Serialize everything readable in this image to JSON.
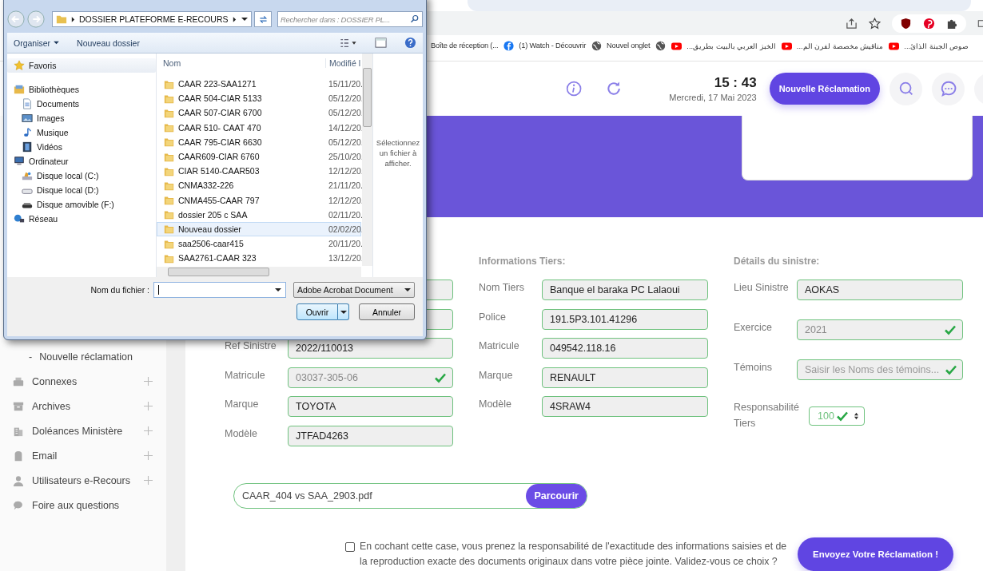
{
  "browser": {
    "bookmarks": [
      {
        "kind": "none",
        "label": "Boîte de réception (..."
      },
      {
        "kind": "facebook",
        "label": "(1) Watch - Découvrir"
      },
      {
        "kind": "globe",
        "label": "Nouvel onglet"
      },
      {
        "kind": "globe"
      },
      {
        "kind": "youtube",
        "label": "الخبز العربي بالبيت بطريق..."
      },
      {
        "kind": "youtube",
        "label": "مناقيش مخصصة لفرن الم..."
      },
      {
        "kind": "youtube",
        "label": "صوص الجبنة الذائ..."
      }
    ]
  },
  "header": {
    "time": "15 : 43",
    "date": "Mercredi, 17 Mai 2023",
    "new_button": "Nouvelle Réclamation"
  },
  "sidebar": {
    "items": [
      {
        "kind": "sub",
        "label": "Nouvelle réclamation",
        "marker": "-"
      },
      {
        "kind": "printer",
        "label": "Connexes",
        "expandable": true
      },
      {
        "kind": "archive",
        "label": "Archives",
        "expandable": true
      },
      {
        "kind": "building",
        "label": "Doléances Ministère",
        "expandable": true
      },
      {
        "kind": "mailbox",
        "label": "Email",
        "expandable": true
      },
      {
        "kind": "user",
        "label": "Utilisateurs e-Recours",
        "expandable": true
      },
      {
        "kind": "faq",
        "label": "Foire aux questions",
        "expandable": false
      }
    ]
  },
  "form": {
    "columns": [
      {
        "fields": [
          {
            "kind": "covered"
          },
          {
            "kind": "covered"
          },
          {
            "kind": "field",
            "label": "Ref Sinistre",
            "value": "2022/110013",
            "valid": false
          },
          {
            "kind": "field",
            "label": "Matricule",
            "value": "03037-305-06",
            "valid": true
          },
          {
            "kind": "field",
            "label": "Marque",
            "value": "TOYOTA",
            "valid": false
          },
          {
            "kind": "field",
            "label": "Modèle",
            "value": "JTFAD4263",
            "valid": false
          }
        ]
      },
      {
        "heading": "Informations Tiers:",
        "fields": [
          {
            "kind": "field",
            "label": "Nom Tiers",
            "value": "Banque el baraka PC Lalaoui",
            "valid": false
          },
          {
            "kind": "field",
            "label": "Police",
            "value": "191.5P3.101.41296",
            "valid": false
          },
          {
            "kind": "field",
            "label": "Matricule",
            "value": "049542.118.16",
            "valid": false
          },
          {
            "kind": "field",
            "label": "Marque",
            "value": "RENAULT",
            "valid": false
          },
          {
            "kind": "field",
            "label": "Modèle",
            "value": "4SRAW4",
            "valid": false
          }
        ]
      }
    ],
    "details": {
      "heading": "Détails du sinistre:",
      "lieu": {
        "label": "Lieu Sinistre",
        "value": "AOKAS"
      },
      "exercice": {
        "label": "Exercice",
        "value": "2021",
        "valid": true
      },
      "temoins": {
        "label": "Témoins",
        "placeholder": "Saisir les Noms des témoins...",
        "valid": true
      },
      "responsabilite": {
        "label": "Responsabilité Tiers",
        "value": "100",
        "valid": true
      }
    },
    "file": {
      "value": "CAAR_404 vs SAA_2903.pdf",
      "button": "Parcourir"
    },
    "consent": {
      "checked": false,
      "text": "En cochant cette case, vous prenez la responsabilité de l'exactitude des informations saisies et de la reproduction exacte des documents originaux dans votre pièce jointe. Validez-vous ce choix ?"
    },
    "submit": "Envoyez Votre Réclamation !"
  },
  "dialog": {
    "path": "DOSSIER PLATEFORME E-RECOURS",
    "search_placeholder": "Rechercher dans : DOSSIER PL...",
    "toolbar": [
      "Organiser",
      "Nouveau dossier"
    ],
    "nav": [
      {
        "kind": "star",
        "label": "Favoris"
      },
      {
        "kind": "library",
        "label": "Bibliothèques",
        "children": [
          {
            "kind": "doc",
            "label": "Documents"
          },
          {
            "kind": "image",
            "label": "Images"
          },
          {
            "kind": "music",
            "label": "Musique"
          },
          {
            "kind": "video",
            "label": "Vidéos"
          }
        ]
      },
      {
        "kind": "computer",
        "label": "Ordinateur",
        "children": [
          {
            "kind": "drive-c",
            "label": "Disque local (C:)"
          },
          {
            "kind": "drive",
            "label": "Disque local (D:)"
          },
          {
            "kind": "removable",
            "label": "Disque amovible (F:)"
          }
        ]
      },
      {
        "kind": "network",
        "label": "Réseau"
      }
    ],
    "columns": [
      "Nom",
      "Modifié l"
    ],
    "files": [
      {
        "name": "CAAR 223-SAA1271",
        "date": "15/11/20.",
        "selected": false
      },
      {
        "name": "CAAR 504-CIAR 5133",
        "date": "05/12/20.",
        "selected": false
      },
      {
        "name": "CAAR 507-CIAR 6700",
        "date": "05/12/20.",
        "selected": false
      },
      {
        "name": "CAAR 510- CAAT 470",
        "date": "14/12/20.",
        "selected": false
      },
      {
        "name": "CAAR 795-CIAR 6630",
        "date": "05/12/20.",
        "selected": false
      },
      {
        "name": "CAAR609-CIAR 6760",
        "date": "25/10/20.",
        "selected": false
      },
      {
        "name": "CIAR 5140-CAAR503",
        "date": "12/12/20.",
        "selected": false
      },
      {
        "name": "CNMA332-226",
        "date": "21/11/20.",
        "selected": false
      },
      {
        "name": "CNMA455-CAAR 797",
        "date": "12/12/20.",
        "selected": false
      },
      {
        "name": "dossier 205 c SAA",
        "date": "02/11/20.",
        "selected": false
      },
      {
        "name": "Nouveau dossier",
        "date": "02/02/20.",
        "selected": true
      },
      {
        "name": "saa2506-caar415",
        "date": "20/11/20.",
        "selected": false
      },
      {
        "name": "SAA2761-CAAR 323",
        "date": "13/12/20.",
        "selected": false
      }
    ],
    "preview": "Sélectionnez un fichier à afficher.",
    "filename_label": "Nom du fichier :",
    "filetype": "Adobe Acrobat Document",
    "buttons": [
      "Ouvrir",
      "Annuler"
    ]
  }
}
